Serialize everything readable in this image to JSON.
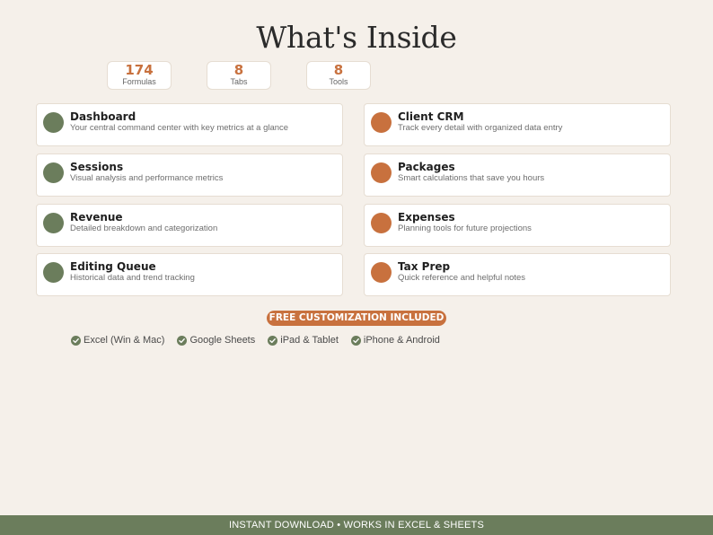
{
  "title": "What's Inside",
  "stats": [
    {
      "value": "174",
      "label": "Formulas"
    },
    {
      "value": "8",
      "label": "Tabs"
    },
    {
      "value": "8",
      "label": "Tools"
    }
  ],
  "colors": {
    "accent": "#c8713e",
    "green": "#6b7d5c",
    "background": "#f5f0ea"
  },
  "left_cards": [
    {
      "title": "Dashboard",
      "desc": "Your central command center with key metrics at a glance"
    },
    {
      "title": "Sessions",
      "desc": "Visual analysis and performance metrics"
    },
    {
      "title": "Revenue",
      "desc": "Detailed breakdown and categorization"
    },
    {
      "title": "Editing Queue",
      "desc": "Historical data and trend tracking"
    }
  ],
  "right_cards": [
    {
      "title": "Client CRM",
      "desc": "Track every detail with organized data entry"
    },
    {
      "title": "Packages",
      "desc": "Smart calculations that save you hours"
    },
    {
      "title": "Expenses",
      "desc": "Planning tools for future projections"
    },
    {
      "title": "Tax Prep",
      "desc": "Quick reference and helpful notes"
    }
  ],
  "badge": "FREE CUSTOMIZATION INCLUDED",
  "platforms": [
    "Excel (Win & Mac)",
    "Google Sheets",
    "iPad & Tablet",
    "iPhone & Android"
  ],
  "footer": "INSTANT DOWNLOAD  •  WORKS IN EXCEL & SHEETS"
}
